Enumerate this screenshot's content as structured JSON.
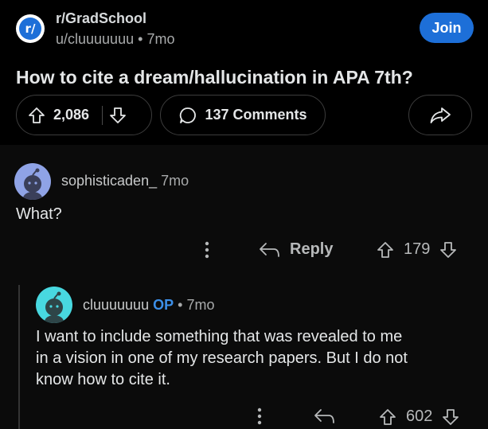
{
  "post": {
    "subreddit": "r/GradSchool",
    "subreddit_icon": "r/",
    "author": "u/cluuuuuuu",
    "separator": "•",
    "age": "7mo",
    "join_label": "Join",
    "title": "How to cite a dream/hallucination in APA 7th?",
    "score": "2,086",
    "comments_label": "137 Comments"
  },
  "comments": [
    {
      "author": "sophisticaden_",
      "age": "7mo",
      "body": "What?",
      "reply_label": "Reply",
      "score": "179",
      "avatar_color": "#8fa3e6"
    },
    {
      "author": "cluuuuuuu",
      "op_label": "OP",
      "separator": "•",
      "age": "7mo",
      "body_lines": [
        "I want to include something that was revealed to me",
        "in a vision in one of my research papers. But I do not",
        "know how to cite it."
      ],
      "score": "602",
      "avatar_color": "#48d8e0"
    }
  ],
  "colors": {
    "accent": "#1d6fd8",
    "op": "#3c8fe8",
    "background": "#0b0b0b"
  }
}
